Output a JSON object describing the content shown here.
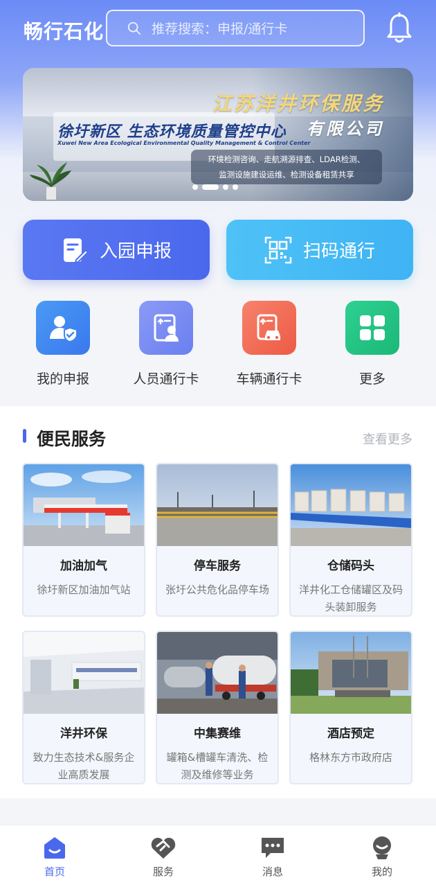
{
  "header": {
    "app_title": "畅行石化",
    "search_placeholder": "推荐搜索：申报/通行卡"
  },
  "banner": {
    "wall_text_cn": "徐圩新区 生态环境质量管控中心",
    "wall_text_en": "Xuwei New Area Ecological Environmental Quality Management & Control Center",
    "title_line1": "江苏洋井环保服务",
    "title_line2": "有限公司",
    "desc_line1": "环境检测咨询、走航溯源排查、LDAR检测、",
    "desc_line2": "监测设施建设运维、检测设备租赁共享",
    "active_slide": 2,
    "slide_count": 4
  },
  "actions": {
    "apply_label": "入园申报",
    "scan_label": "扫码通行"
  },
  "quick_links": [
    {
      "label": "我的申报",
      "icon": "my-application-icon",
      "color": "#3f86f0"
    },
    {
      "label": "人员通行卡",
      "icon": "personnel-pass-icon",
      "color": "#6a7ff0"
    },
    {
      "label": "车辆通行卡",
      "icon": "vehicle-pass-icon",
      "color": "#f0684f"
    },
    {
      "label": "更多",
      "icon": "more-grid-icon",
      "color": "#22c284"
    }
  ],
  "services": {
    "title": "便民服务",
    "more_label": "查看更多",
    "cards": [
      {
        "name": "加油加气",
        "desc": "徐圩新区加油加气站"
      },
      {
        "name": "停车服务",
        "desc": "张圩公共危化品停车场"
      },
      {
        "name": "仓储码头",
        "desc": "洋井化工仓储罐区及码头装卸服务"
      },
      {
        "name": "洋井环保",
        "desc": "致力生态技术&服务企业高质发展"
      },
      {
        "name": "中集赛维",
        "desc": "罐箱&槽罐车清洗、检测及维修等业务"
      },
      {
        "name": "酒店预定",
        "desc": "格林东方市政府店"
      }
    ]
  },
  "tabbar": {
    "items": [
      {
        "label": "首页",
        "icon": "home-icon",
        "active": true
      },
      {
        "label": "服务",
        "icon": "service-icon",
        "active": false
      },
      {
        "label": "消息",
        "icon": "message-icon",
        "active": false
      },
      {
        "label": "我的",
        "icon": "profile-icon",
        "active": false
      }
    ]
  },
  "colors": {
    "primary": "#4a68ec",
    "scan": "#3fb3f4",
    "tab_inactive": "#555555"
  }
}
